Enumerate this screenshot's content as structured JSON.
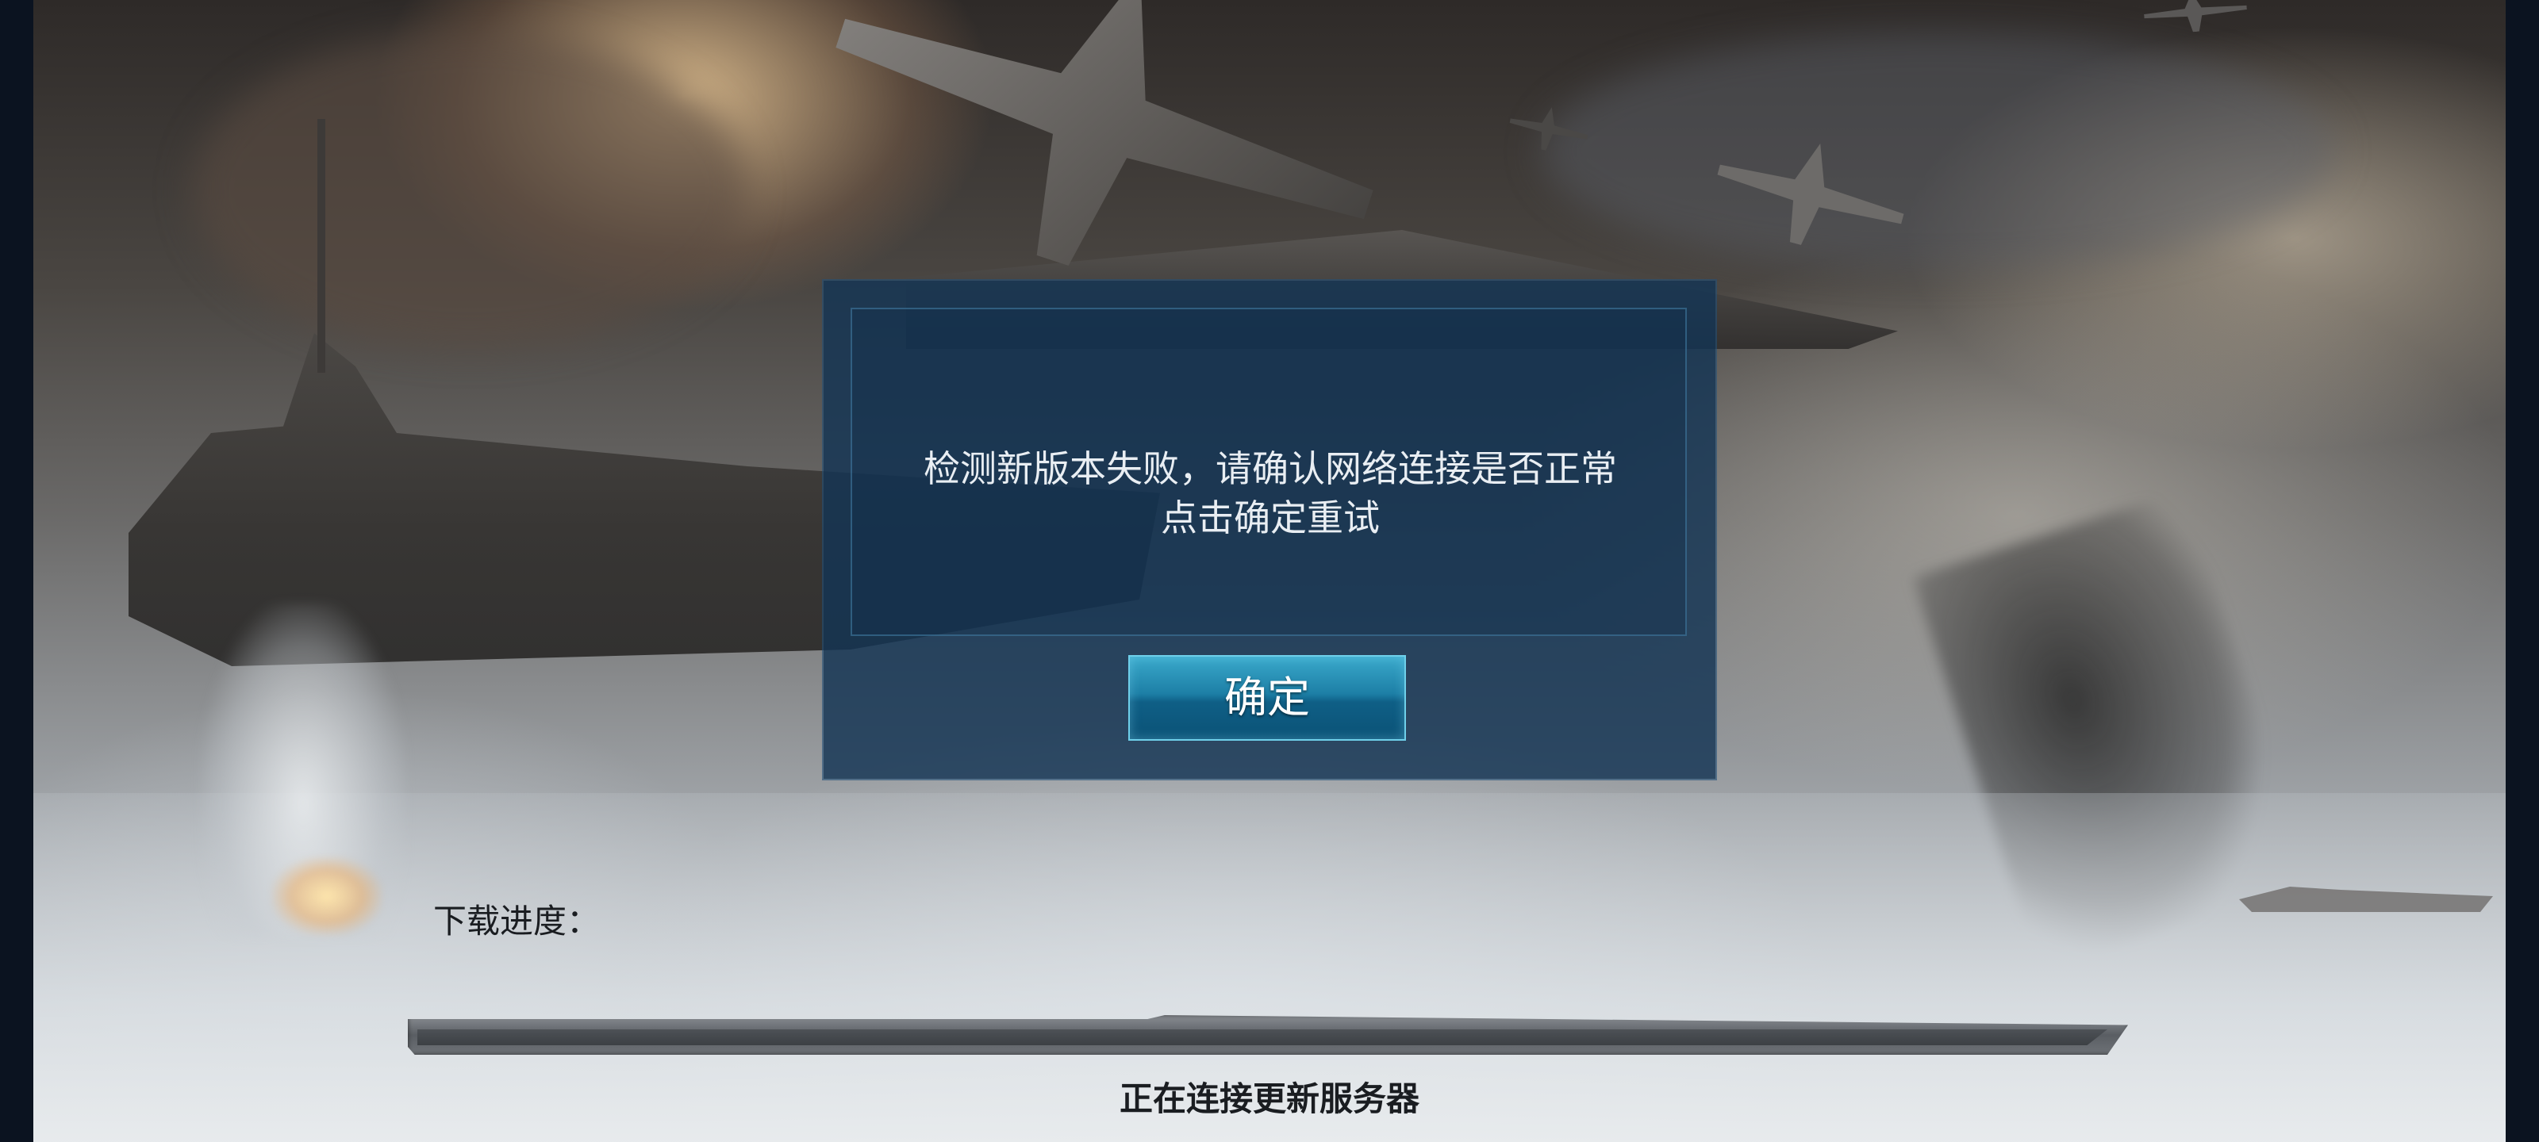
{
  "dialog": {
    "message_line1": "检测新版本失败，请确认网络连接是否正常",
    "message_line2": "点击确定重试",
    "ok_label": "确定"
  },
  "download": {
    "label": "下载进度：",
    "progress": 0,
    "status": "正在连接更新服务器"
  },
  "colors": {
    "dialog_bg": "#14344f",
    "button_accent": "#1d7fa6",
    "progress_fill": "#2a8fc0"
  }
}
